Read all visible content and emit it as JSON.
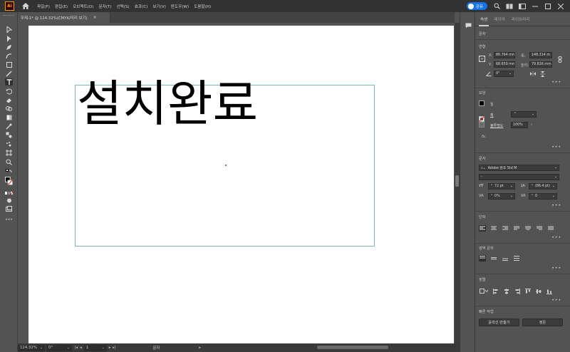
{
  "app": {
    "logo": "Ai"
  },
  "menu": {
    "items": [
      "파일(F)",
      "편집(E)",
      "오브젝트(O)",
      "문자(T)",
      "선택(S)",
      "효과(C)",
      "보기(V)",
      "윈도우(W)",
      "도움말(H)"
    ],
    "share_label": "공유"
  },
  "document": {
    "tab_title": "무제-1* @ 124.32%(CMYK/미리 보기)",
    "tab_close": "×",
    "text_content": "설치완료"
  },
  "statusbar": {
    "zoom": "124.32%",
    "rotation": "0°",
    "artboard_number": "1",
    "tool_name": "문자"
  },
  "panel": {
    "tabs": [
      "속성",
      "레이어",
      "라이브러리"
    ],
    "section_type": "문자",
    "transform": {
      "title": "변형",
      "x_label": "X:",
      "x_value": "86.764 mm",
      "y_label": "Y:",
      "y_value": "68.659 mm",
      "w_label": "폭:",
      "w_value": "148.314 m",
      "h_label": "높이:",
      "h_value": "79.816 mm",
      "angle_value": "0°"
    },
    "appearance": {
      "title": "모양",
      "fill_label": "칠",
      "stroke_label": "획",
      "opacity_label": "불투명도",
      "opacity_value": "100%",
      "fx_label": "fx."
    },
    "character": {
      "title": "문자",
      "font_family": "Adobe 명조 Std M",
      "font_style": "-",
      "font_size": "72 pt",
      "leading": "(86.4 pt)",
      "tracking": "0%",
      "kerning": "0"
    },
    "paragraph": {
      "title": "단락"
    },
    "area_type": {
      "title": "영역 문자"
    },
    "align": {
      "title": "정렬"
    },
    "quick_actions": {
      "title": "빠른 작업",
      "outline_button": "윤곽선 만들기",
      "arrange_button": "정돈"
    },
    "more": "•••"
  },
  "colors": {
    "menubar_bg": "#323232",
    "panel_bg": "#535353",
    "share_blue": "#1473e6",
    "frame_cyan": "#7fb6bd"
  }
}
